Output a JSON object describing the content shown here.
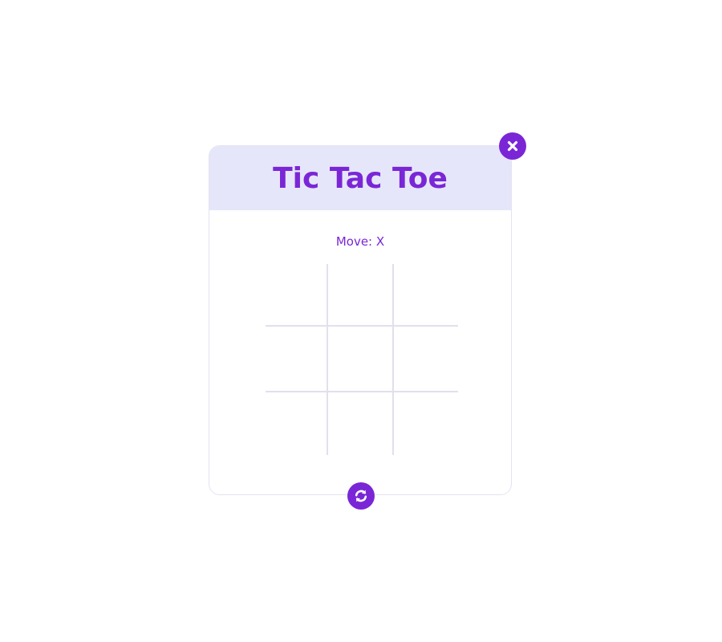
{
  "game": {
    "title": "Tic Tac Toe",
    "status_text": "Move: X",
    "board": [
      [
        "",
        "",
        ""
      ],
      [
        "",
        "",
        ""
      ],
      [
        "",
        "",
        ""
      ]
    ]
  },
  "controls": {
    "close_icon": "close-icon",
    "reset_icon": "refresh-icon"
  },
  "colors": {
    "accent": "#7a26d6",
    "header_bg": "#e6e6fa",
    "grid_line": "#e0e0ee",
    "card_border": "#e3e3f0"
  }
}
